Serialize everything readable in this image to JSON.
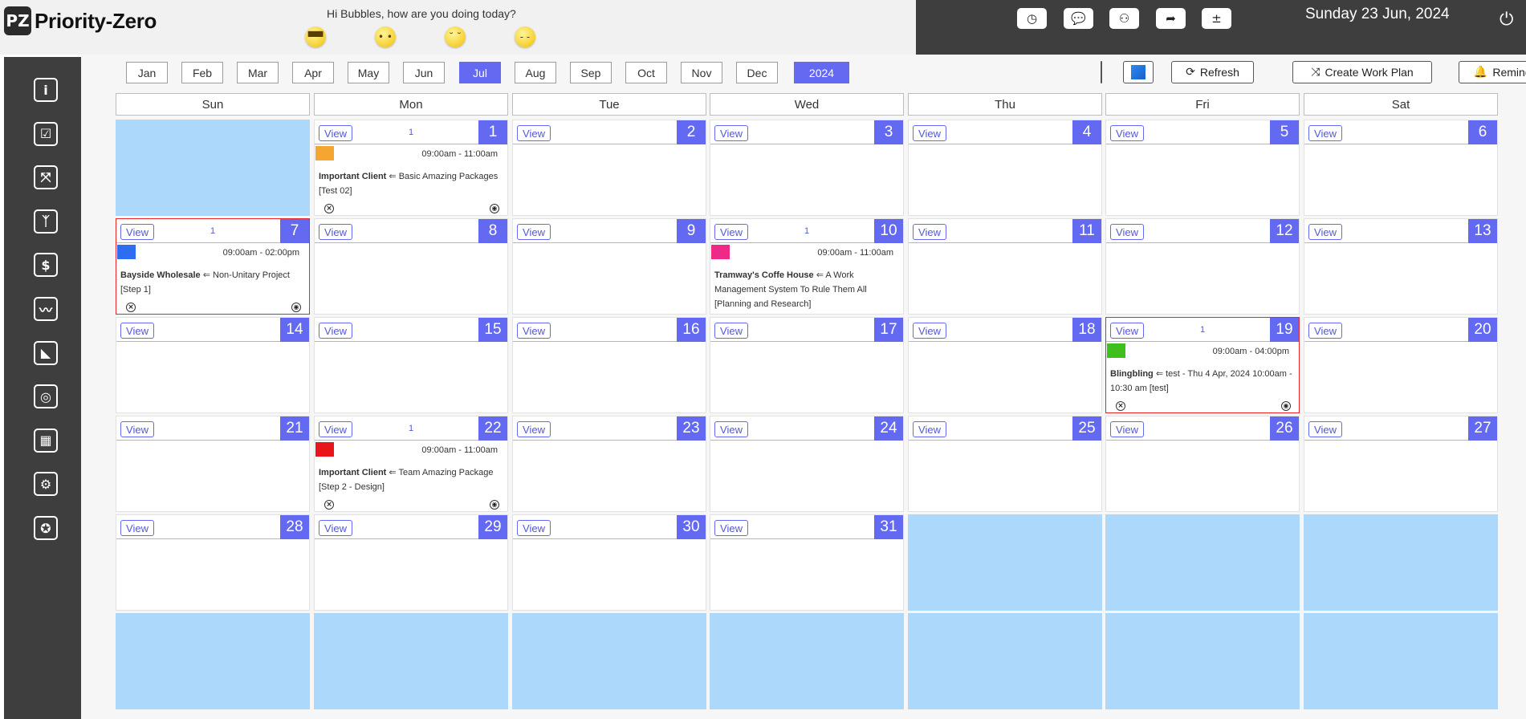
{
  "app": {
    "logo_mark": "PZ",
    "title": "Priority-Zero",
    "greeting": "Hi Bubbles, how are you doing today?",
    "moods": [
      {
        "icon": "cool-face-icon",
        "glyph": "▀▀"
      },
      {
        "icon": "worried-face-icon",
        "glyph": "• •"
      },
      {
        "icon": "sad-face-icon",
        "glyph": "˘ ˘"
      },
      {
        "icon": "sleepy-face-icon",
        "glyph": "- -"
      }
    ],
    "date": "Sunday 23 Jun, 2024"
  },
  "header_tools": [
    {
      "name": "clock-icon",
      "glyph": "◷"
    },
    {
      "name": "chat-bubble-icon",
      "glyph": "💬"
    },
    {
      "name": "team-icon",
      "glyph": "⚇"
    },
    {
      "name": "share-arrow-icon",
      "glyph": "➦"
    },
    {
      "name": "calculator-icon",
      "glyph": "±"
    }
  ],
  "sidebar": [
    {
      "name": "info-icon",
      "glyph": "i"
    },
    {
      "name": "checklist-icon",
      "glyph": "☑"
    },
    {
      "name": "workflow-icon",
      "glyph": "⤧"
    },
    {
      "name": "people-icon",
      "glyph": "ᛉ"
    },
    {
      "name": "dollar-icon",
      "glyph": "$"
    },
    {
      "name": "chart-line-icon",
      "glyph": "〰"
    },
    {
      "name": "megaphone-icon",
      "glyph": "◣"
    },
    {
      "name": "target-icon",
      "glyph": "◎"
    },
    {
      "name": "modules-icon",
      "glyph": "▦"
    },
    {
      "name": "settings-gear-icon",
      "glyph": "⚙"
    },
    {
      "name": "badge-icon",
      "glyph": "✪"
    }
  ],
  "months": [
    "Jan",
    "Feb",
    "Mar",
    "Apr",
    "May",
    "Jun",
    "Jul",
    "Aug",
    "Sep",
    "Oct",
    "Nov",
    "Dec"
  ],
  "active_month": "Jul",
  "year": "2024",
  "toolbar": {
    "refresh": "Refresh",
    "create_work_plan": "Create Work Plan",
    "reminder": "Reminder"
  },
  "days": [
    "Sun",
    "Mon",
    "Tue",
    "Wed",
    "Thu",
    "Fri",
    "Sat"
  ],
  "view_label": "View",
  "first_weekday": 1,
  "days_in_month": 31,
  "events": {
    "1": {
      "count": "1",
      "color": "#f5a532",
      "time": "09:00am - 11:00am",
      "client": "Important Client",
      "arrow": " ⇐ ",
      "project": "Basic Amazing Packages",
      "step": "[Test 02]",
      "highlight": false
    },
    "7": {
      "count": "1",
      "color": "#2e6df2",
      "time": "09:00am - 02:00pm",
      "client": "Bayside Wholesale",
      "arrow": " ⇐ ",
      "project": "Non-Unitary Project",
      "step": "[Step 1]",
      "highlight": true
    },
    "10": {
      "count": "1",
      "color": "#ee2a86",
      "time": "09:00am - 11:00am",
      "client": "Tramway's Coffe House",
      "arrow": " ⇐ ",
      "project": "A Work Management System To Rule Them All",
      "step": "[Planning and Research]",
      "highlight": false,
      "no_actions": true
    },
    "19": {
      "count": "1",
      "color": "#3fbf1b",
      "time": "09:00am - 04:00pm",
      "client": "Blingbling",
      "arrow": " ⇐ ",
      "project": "test - Thu 4 Apr, 2024 10:00am - 10:30 am",
      "step": "[test]",
      "highlight": true
    },
    "22": {
      "count": "1",
      "color": "#e8161b",
      "time": "09:00am - 11:00am",
      "client": "Important Client",
      "arrow": " ⇐ ",
      "project": "Team Amazing Package",
      "step": "[Step 2 - Design]",
      "highlight": false
    }
  },
  "colors": {
    "accent": "#6369f0",
    "empty_cell": "#acd8fb",
    "header_dark": "#3e3e3e"
  }
}
